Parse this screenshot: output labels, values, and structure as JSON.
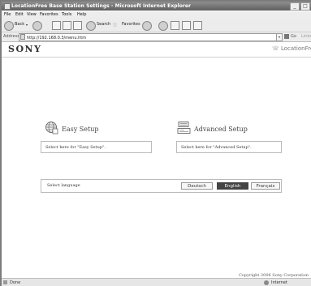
{
  "window": {
    "title": "LocationFree Base Station Settings - Microsoft Internet Explorer",
    "minimize_label": "_",
    "maximize_label": "□"
  },
  "menu": [
    "File",
    "Edit",
    "View",
    "Favorites",
    "Tools",
    "Help"
  ],
  "toolbar": {
    "back_label": "Back",
    "search_label": "Search",
    "favorites_label": "Favorites"
  },
  "address": {
    "label": "Address",
    "url": "http://192.168.0.3/menu.htm",
    "go_label": "Go",
    "links_label": "Links"
  },
  "header": {
    "brand": "SONY",
    "product_logo": "LocationFree"
  },
  "easy_setup": {
    "title": "Easy Setup",
    "description": "Select here for \"Easy Setup\"."
  },
  "advanced_setup": {
    "title": "Advanced Setup",
    "description": "Select here for \"Advanced Setup\"."
  },
  "language": {
    "label": "Select language",
    "options": [
      "Deutsch",
      "English",
      "Français"
    ],
    "selected": "English"
  },
  "footer": {
    "copyright": "Copyright 2006 Sony Corporation"
  },
  "status": {
    "left": "Done",
    "zone": "Internet"
  },
  "colors": {
    "titlebar": "#6f6f6f",
    "selected_language_bg": "#444444",
    "border": "#bbbbbb"
  }
}
